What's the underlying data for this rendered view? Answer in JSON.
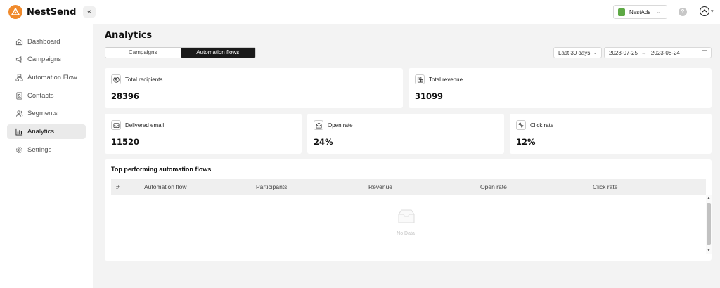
{
  "app": {
    "name": "NestSend"
  },
  "topbar": {
    "collapse_glyph": "«",
    "shop_name": "NestAds",
    "help_glyph": "?"
  },
  "sidebar": {
    "items": [
      {
        "label": "Dashboard",
        "icon": "home-icon"
      },
      {
        "label": "Campaigns",
        "icon": "megaphone-icon"
      },
      {
        "label": "Automation Flow",
        "icon": "flow-icon"
      },
      {
        "label": "Contacts",
        "icon": "contacts-icon"
      },
      {
        "label": "Segments",
        "icon": "users-icon"
      },
      {
        "label": "Analytics",
        "icon": "chart-icon",
        "active": true
      },
      {
        "label": "Settings",
        "icon": "gear-icon"
      }
    ]
  },
  "page": {
    "title": "Analytics"
  },
  "tabs": [
    {
      "label": "Campaigns",
      "active": false
    },
    {
      "label": "Automation flows",
      "active": true
    }
  ],
  "filters": {
    "range": "Last 30 days",
    "start_date": "2023-07-25",
    "arrow": "→",
    "end_date": "2023-08-24"
  },
  "metrics": {
    "total_recipients": {
      "label": "Total recipients",
      "value": "28396"
    },
    "total_revenue": {
      "label": "Total revenue",
      "value": "31099"
    },
    "delivered_email": {
      "label": "Delivered email",
      "value": "11520"
    },
    "open_rate": {
      "label": "Open rate",
      "value": "24%"
    },
    "click_rate": {
      "label": "Click rate",
      "value": "12%"
    }
  },
  "table": {
    "title": "Top performing automation flows",
    "columns": [
      "#",
      "Automation flow",
      "Participants",
      "Revenue",
      "Open rate",
      "Click rate"
    ],
    "empty_text": "No Data"
  },
  "colors": {
    "brand": "#f08a2c",
    "active_tab": "#1a1a1a",
    "shop_badge": "#5ea945"
  }
}
